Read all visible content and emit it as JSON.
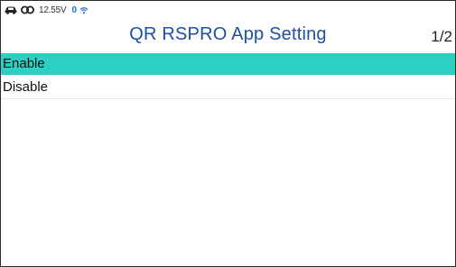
{
  "status_bar": {
    "car_icon": "car-icon",
    "link_icon": "obd-link-icon",
    "voltage": "12.55V",
    "indicator_value": "0",
    "wifi_icon": "wifi-icon"
  },
  "header": {
    "title": "QR RSPRO App Setting",
    "page_indicator": "1/2"
  },
  "options": [
    {
      "label": "Enable",
      "selected": true
    },
    {
      "label": "Disable",
      "selected": false
    }
  ],
  "colors": {
    "selection": "#2ccfc3",
    "title": "#1f4fa0",
    "indicator": "#1a6fd0"
  }
}
